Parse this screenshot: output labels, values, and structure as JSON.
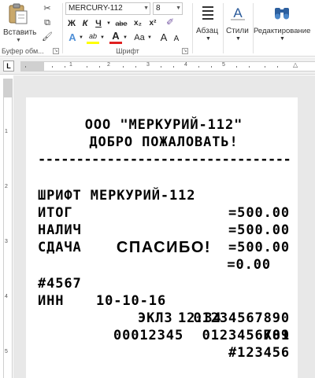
{
  "ribbon": {
    "clipboard": {
      "paste_label": "Вставить",
      "group_label": "Буфер обм..."
    },
    "font": {
      "font_name": "MERCURY-112",
      "font_size": "8",
      "bold": "Ж",
      "italic": "К",
      "underline": "Ч",
      "strikethrough": "abe",
      "subscript": "x₂",
      "superscript": "x²",
      "case": "Aa",
      "grow": "A",
      "shrink": "A",
      "group_label": "Шрифт"
    },
    "paragraph": {
      "label": "Абзац"
    },
    "styles": {
      "label": "Стили"
    },
    "editing": {
      "label": "Редактирование"
    }
  },
  "ruler": {
    "tab_symbol": "L",
    "numbers": [
      "1",
      "2",
      "3",
      "4",
      "5"
    ],
    "vnumbers": [
      "1",
      "2",
      "3",
      "4",
      "5"
    ]
  },
  "receipt": {
    "line1": "ООО \"МЕРКУРИЙ-112\"",
    "line2": "ДОБРО ПОЖАЛОВАТЬ!",
    "separator": "------------------------------------",
    "rows": [
      {
        "left": "ШРИФТ МЕРКУРИЙ-112",
        "right": "=500.00"
      },
      {
        "left": "ИТОГ",
        "right": "=500.00"
      },
      {
        "left": "НАЛИЧ",
        "right": "=500.00"
      },
      {
        "left": "СДАЧА",
        "right": "=0.00"
      }
    ],
    "thanks": "СПАСИБО!",
    "info": {
      "check_no": "#4567",
      "date": "10-10-16",
      "time": "12:34",
      "cashier": "К01"
    },
    "inn_label": "ИНН",
    "inn_value": "01234567890",
    "eklz_label": "ЭКЛЗ",
    "eklz_value": "0123456789",
    "doc_no": "00012345",
    "kpk_no": "#123456"
  }
}
